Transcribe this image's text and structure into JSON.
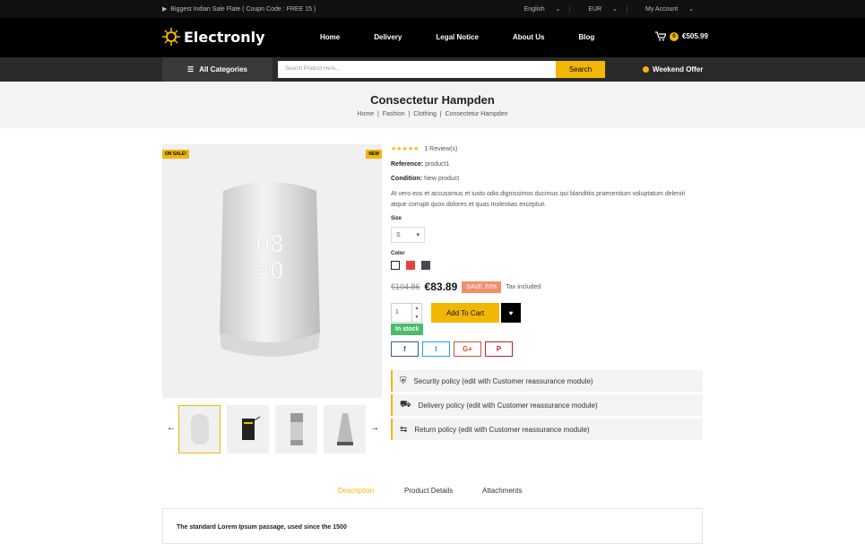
{
  "topbar": {
    "promo": "Biggest Indian Sale Flate ( Coupn Code : FREE 15 )",
    "language": "English",
    "currency": "EUR",
    "account": "My Account"
  },
  "header": {
    "logo": "Electronly",
    "nav": [
      "Home",
      "Delivery",
      "Legal Notice",
      "About Us",
      "Blog"
    ],
    "cart_count": "0",
    "cart_total": "€505.99"
  },
  "catbar": {
    "all_categories": "All Categories",
    "search_placeholder": "Search Product Here...",
    "search_button": "Search",
    "weekend_offer": "Weekend Offer"
  },
  "page": {
    "title": "Consectetur Hampden",
    "breadcrumb": [
      "Home",
      "Fashion",
      "Clothing",
      "Consectetur Hampden"
    ]
  },
  "gallery": {
    "badge_sale": "ON SALE!",
    "badge_new": "NEW",
    "display_top": "08",
    "display_bottom": "30"
  },
  "product": {
    "rating": 5,
    "stars": "★★★★★",
    "reviews": "1 Review(s)",
    "reference_label": "Reference:",
    "reference": "product1",
    "condition_label": "Condition:",
    "condition": "New product",
    "description": "At vero eos et accusamus et iusto odio dignissimos ducimus qui blanditiis praesentium voluptatum deleniti atque corrupti quos dolores et quas molestias excepturi.",
    "size_label": "Size",
    "size_value": "S",
    "color_label": "Color",
    "colors": [
      "#ffffff",
      "#e2463a",
      "#434a54"
    ],
    "old_price": "€104.86",
    "price": "€83.89",
    "discount": "SAVE 20%",
    "tax": "Tax included",
    "quantity": "1",
    "add_to_cart": "Add To Cart",
    "stock": "In stock",
    "share": [
      {
        "label": "f",
        "color": "#3b5998"
      },
      {
        "label": "t",
        "color": "#1da1f2"
      },
      {
        "label": "G+",
        "color": "#dd4b39"
      },
      {
        "label": "P",
        "color": "#cb2027"
      }
    ]
  },
  "policies": [
    {
      "icon": "shield-icon",
      "text": "Security policy (edit with Customer reassurance module)"
    },
    {
      "icon": "truck-icon",
      "text": "Delivery policy (edit with Customer reassurance module)"
    },
    {
      "icon": "exchange-icon",
      "text": "Return policy (edit with Customer reassurance module)"
    }
  ],
  "tabs": [
    "Description",
    "Product Details",
    "Attachments"
  ],
  "description_heading": "The standard Lorem Ipsum passage, used since the 1500",
  "colors": {
    "accent": "#f2b705",
    "dark": "#000000"
  }
}
